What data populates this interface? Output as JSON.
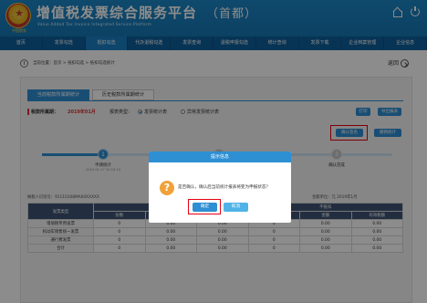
{
  "header": {
    "emblem_caption": "中国税务",
    "title": "增值税发票综合服务平台",
    "region": "（首都）",
    "subtitle": "Value Added Tax Invoice Integrated Service Platform",
    "icons": [
      "home-icon",
      "power-icon"
    ]
  },
  "nav": {
    "items": [
      "首页",
      "发票勾选",
      "抵扣勾选",
      "代办退税勾选",
      "发票查询",
      "退税申报勾选",
      "统计查询",
      "发票下载",
      "企业档案管理",
      "企业信息"
    ]
  },
  "breadcrumb": {
    "text": "当前位置：首页 > 抵扣勾选 > 抵扣勾选统计",
    "return_label": "返回"
  },
  "tabs": {
    "current": "当前税款所属期统计",
    "history": "历史税款所属期统计"
  },
  "filter": {
    "period_label": "税款所属期：",
    "period_value": "2019年01月",
    "type_label": "报表类型：",
    "option_selected": "发票统计表",
    "option_other": "异常发票统计表"
  },
  "actions": {
    "print": "打印",
    "export": "导出报表",
    "confirm": "确认签名",
    "cancel_stat": "撤销统计"
  },
  "steps": [
    {
      "num": "1",
      "label": "申请统计",
      "sub": "2019-01-17 10:10:10"
    },
    {
      "num": "2",
      "label": "确认签名",
      "sub": ""
    },
    {
      "num": "3",
      "label": "确认完成",
      "sub": ""
    }
  ],
  "table": {
    "tax_info": "纳税人识别号：91110108MA00XXXXX",
    "date_info": "金额单位：元  2019年1月",
    "group_header": "发票类型",
    "col_group1": "勾选",
    "col_group2": "不抵扣",
    "subheaders": [
      "份数",
      "金额",
      "有效税额",
      "份数",
      "金额",
      "有效税额"
    ],
    "rows": [
      {
        "name": "增值税专用发票",
        "cells": [
          "0",
          "0.00",
          "0.00",
          "0",
          "0.00",
          "0.00"
        ]
      },
      {
        "name": "机动车销售统一发票",
        "cells": [
          "0",
          "0.00",
          "0.00",
          "0",
          "0.00",
          "0.00"
        ]
      },
      {
        "name": "通行费发票",
        "cells": [
          "0",
          "0.00",
          "0.00",
          "0",
          "0.00",
          "0.00"
        ]
      },
      {
        "name": "合计",
        "cells": [
          "0",
          "0.00",
          "0.00",
          "0",
          "0.00",
          "0.00"
        ]
      }
    ]
  },
  "modal": {
    "title": "提示信息",
    "message": "是否确认，确认后当前统计报表将变为申报状态？",
    "ok": "确定",
    "cancel": "取消"
  },
  "colors": {
    "header_blue": "#1577b5",
    "accent": "#2e8fd3",
    "highlight_red": "#e60012",
    "warning": "#f0a13a"
  }
}
